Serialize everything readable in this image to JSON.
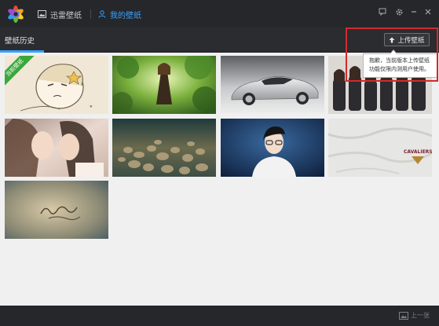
{
  "header": {
    "tabs": [
      {
        "label": "迅雷壁纸"
      },
      {
        "label": "我的壁纸"
      }
    ]
  },
  "subheader": {
    "tab_label": "壁纸历史",
    "upload_label": "上传壁纸"
  },
  "tooltip": {
    "line1": "抱歉，当前版本上传壁纸",
    "line2": "功能仅限内测用户使用。"
  },
  "gallery": {
    "current_badge": "当前壁纸",
    "items": [
      {
        "name": "cartoon-girl"
      },
      {
        "name": "forest-girl"
      },
      {
        "name": "silver-car"
      },
      {
        "name": "group-girls"
      },
      {
        "name": "two-girls"
      },
      {
        "name": "stones"
      },
      {
        "name": "young-man"
      },
      {
        "name": "cavaliers-shirt"
      },
      {
        "name": "blurred-text"
      }
    ]
  },
  "footer": {
    "prev_label": "上一张"
  },
  "colors": {
    "accent": "#36a3ff",
    "highlight": "#d22b2b",
    "badge": "#39a83a"
  }
}
